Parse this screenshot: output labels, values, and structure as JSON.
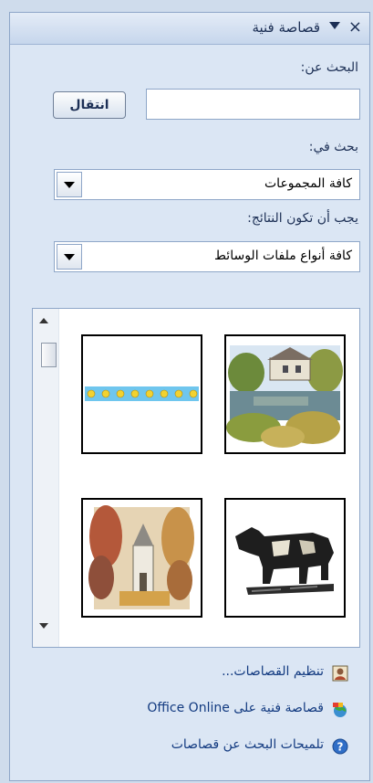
{
  "pane": {
    "title": "قصاصة فنية",
    "close_icon": "×"
  },
  "search": {
    "label": "البحث عن:",
    "value": "",
    "go_label": "انتقال"
  },
  "search_in": {
    "label": "بحث في:",
    "selected": "كافة المجموعات"
  },
  "result_type": {
    "label": "يجب أن تكون النتائج:",
    "selected": "كافة أنواع ملفات الوسائط"
  },
  "results": {
    "items": [
      {
        "icon": "dotted-border-clipart"
      },
      {
        "icon": "lake-house-clipart"
      },
      {
        "icon": "church-trees-clipart"
      },
      {
        "icon": "cow-clipart"
      }
    ]
  },
  "links": {
    "organize": "تنظيم القصاصات...",
    "online": "قصاصة فنية على Office Online",
    "tips": "تلميحات البحث عن قصاصات"
  },
  "colors": {
    "link": "#123a80",
    "pane_bg": "#dbe6f4",
    "title_text": "#1c2f55"
  }
}
